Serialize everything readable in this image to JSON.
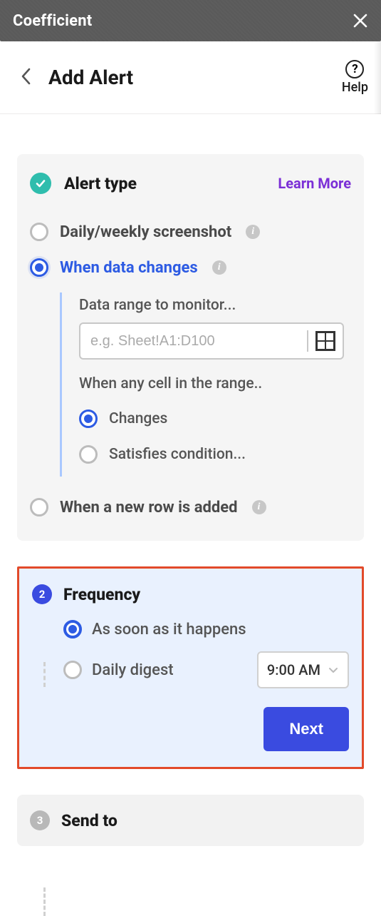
{
  "app": {
    "title": "Coefficient"
  },
  "page": {
    "title": "Add Alert",
    "help_label": "Help"
  },
  "alert_type": {
    "title": "Alert type",
    "learn_more": "Learn More",
    "options": {
      "screenshot": "Daily/weekly screenshot",
      "data_changes": "When data changes",
      "new_row": "When a new row is added"
    },
    "data_changes_section": {
      "range_label": "Data range to monitor...",
      "range_placeholder": "e.g. Sheet!A1:D100",
      "range_cond_label": "When any cell in the range..",
      "cond_changes": "Changes",
      "cond_satisfies": "Satisfies condition..."
    }
  },
  "frequency": {
    "step": "2",
    "title": "Frequency",
    "asap": "As soon as it happens",
    "daily_digest": "Daily digest",
    "time": "9:00 AM",
    "next": "Next"
  },
  "send_to": {
    "step": "3",
    "title": "Send to"
  }
}
